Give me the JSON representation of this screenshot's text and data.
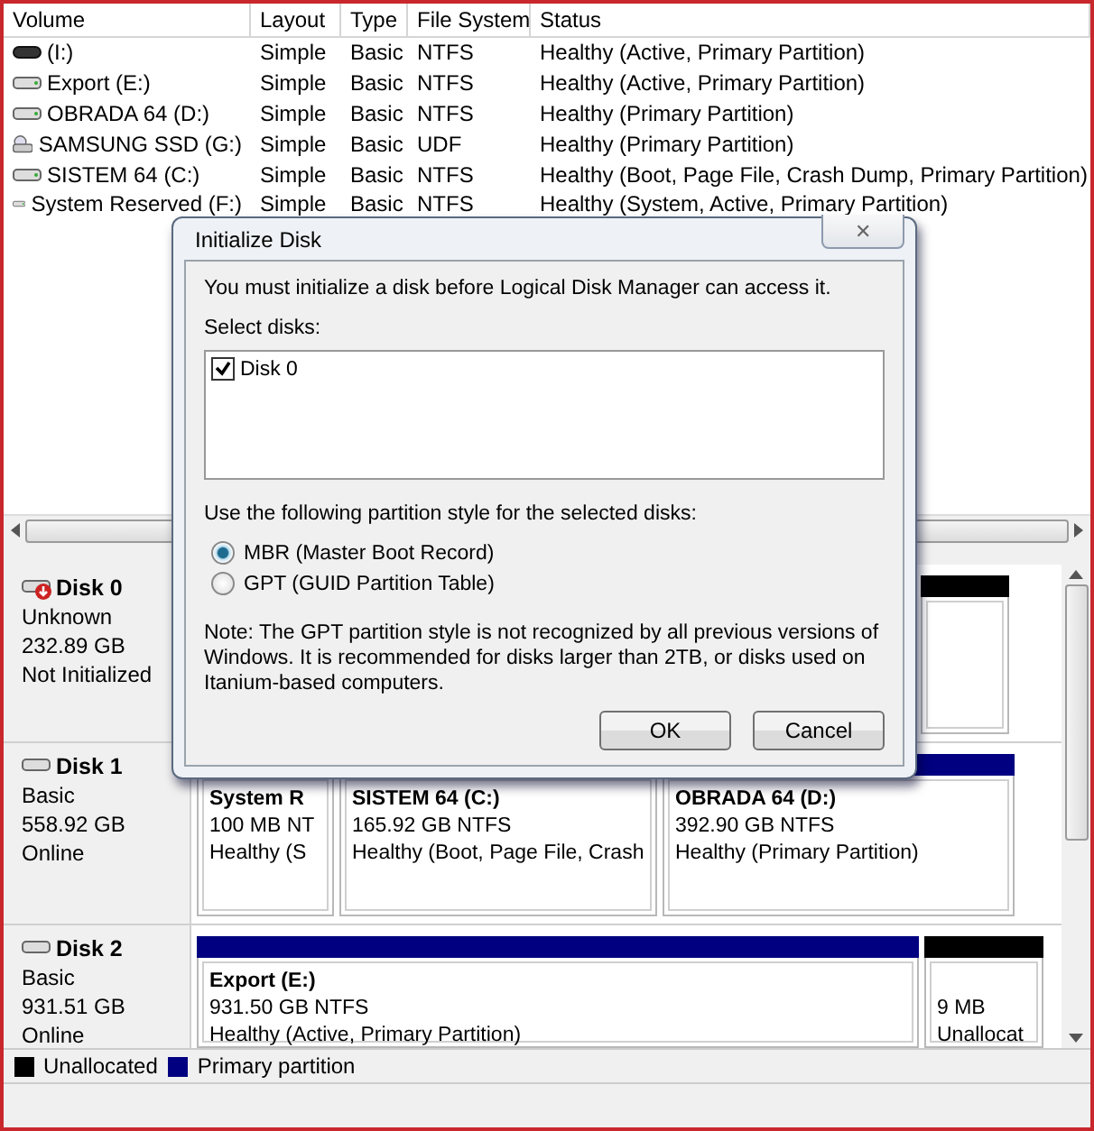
{
  "volume_table": {
    "columns": [
      "Volume",
      "Layout",
      "Type",
      "File System",
      "Status"
    ],
    "rows": [
      {
        "kind": "dark",
        "cells": [
          "(I:)",
          "Simple",
          "Basic",
          "NTFS",
          "Healthy (Active, Primary Partition)"
        ]
      },
      {
        "kind": "drive",
        "cells": [
          "Export (E:)",
          "Simple",
          "Basic",
          "NTFS",
          "Healthy (Active, Primary Partition)"
        ]
      },
      {
        "kind": "drive",
        "cells": [
          "OBRADA 64 (D:)",
          "Simple",
          "Basic",
          "NTFS",
          "Healthy (Primary Partition)"
        ]
      },
      {
        "kind": "disc",
        "cells": [
          "SAMSUNG SSD (G:)",
          "Simple",
          "Basic",
          "UDF",
          "Healthy (Primary Partition)"
        ]
      },
      {
        "kind": "drive",
        "cells": [
          "SISTEM 64 (C:)",
          "Simple",
          "Basic",
          "NTFS",
          "Healthy (Boot, Page File, Crash Dump, Primary Partition)"
        ]
      },
      {
        "kind": "drive",
        "cells": [
          "System Reserved (F:)",
          "Simple",
          "Basic",
          "NTFS",
          "Healthy (System, Active, Primary Partition)"
        ]
      }
    ]
  },
  "disks": [
    {
      "name": "Disk 0",
      "kind": "uninitialized",
      "lines": [
        "Unknown",
        "232.89 GB",
        "Not Initialized"
      ],
      "partitions": [
        {
          "kind": "unallocated"
        }
      ]
    },
    {
      "name": "Disk 1",
      "kind": "basic",
      "lines": [
        "Basic",
        "558.92 GB",
        "Online"
      ],
      "partitions": [
        {
          "kind": "primary",
          "title": "System R",
          "lines": [
            "100 MB NT",
            "Healthy (S"
          ]
        },
        {
          "kind": "primary",
          "title": "SISTEM 64  (C:)",
          "lines": [
            "165.92 GB NTFS",
            "Healthy (Boot, Page File, Crash"
          ]
        },
        {
          "kind": "primary",
          "title": "OBRADA 64  (D:)",
          "lines": [
            "392.90 GB NTFS",
            "Healthy (Primary Partition)"
          ]
        }
      ]
    },
    {
      "name": "Disk 2",
      "kind": "basic",
      "lines": [
        "Basic",
        "931.51 GB",
        "Online"
      ],
      "partitions": [
        {
          "kind": "primary",
          "title": "Export  (E:)",
          "lines": [
            "931.50 GB NTFS",
            "Healthy (Active, Primary Partition)"
          ]
        },
        {
          "kind": "unallocated",
          "lines": [
            "9 MB",
            "Unallocat"
          ]
        }
      ]
    }
  ],
  "legend": [
    {
      "label": "Unallocated",
      "color": "#000000"
    },
    {
      "label": "Primary partition",
      "color": "#000080"
    }
  ],
  "dialog": {
    "title": "Initialize Disk",
    "close": "✕",
    "intro": "You must initialize a disk before Logical Disk Manager can access it.",
    "select_label": "Select disks:",
    "disks": [
      {
        "label": "Disk 0",
        "checked": true
      }
    ],
    "style_label": "Use the following partition style for the selected disks:",
    "styles": [
      {
        "label": "MBR (Master Boot Record)",
        "selected": true
      },
      {
        "label": "GPT (GUID Partition Table)",
        "selected": false
      }
    ],
    "note": "Note: The GPT partition style is not recognized by all previous versions of Windows. It is recommended for disks larger than 2TB, or disks used on Itanium-based computers.",
    "buttons": [
      "OK",
      "Cancel"
    ]
  }
}
